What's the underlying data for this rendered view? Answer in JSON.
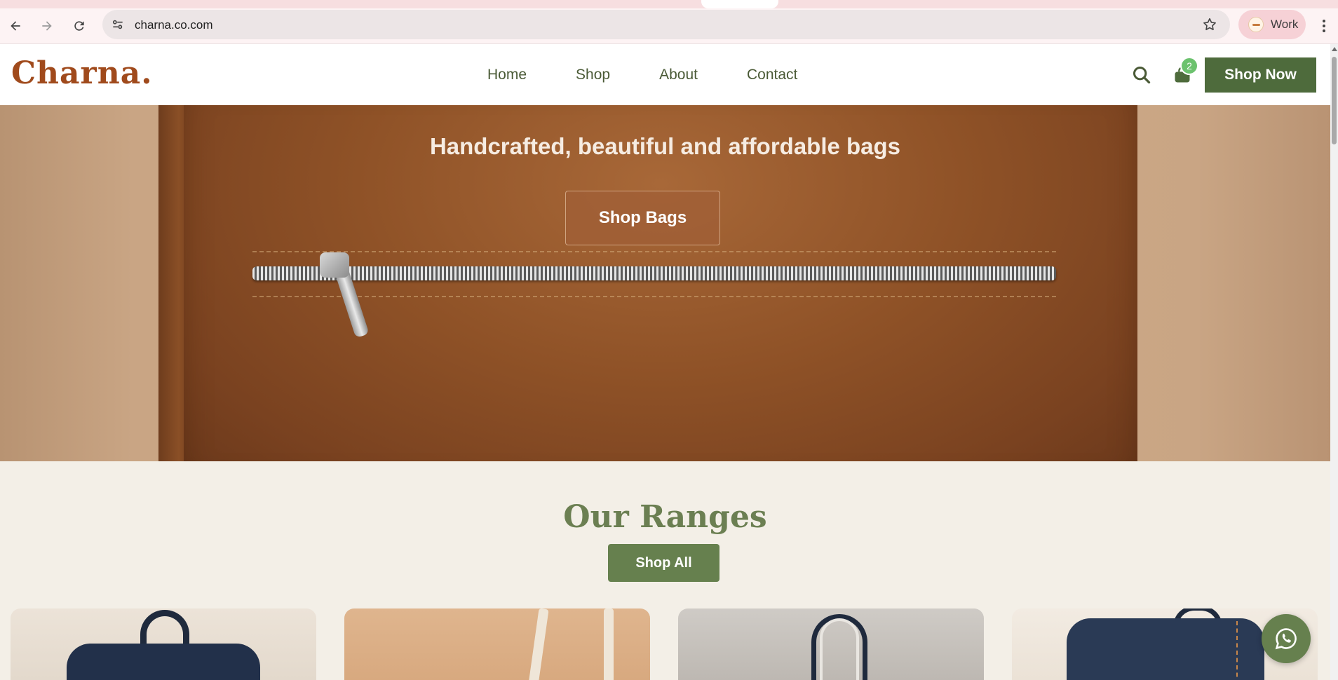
{
  "browser": {
    "url": "charna.co.com",
    "profile_label": "Work",
    "icons": {
      "back": "arrow-left-icon",
      "forward": "arrow-right-icon",
      "reload": "reload-icon",
      "site_info": "tune-icon",
      "bookmark": "star-icon",
      "menu": "more-vert-icon"
    }
  },
  "header": {
    "logo": "Charna.",
    "nav": [
      "Home",
      "Shop",
      "About",
      "Contact"
    ],
    "cart_count": "2",
    "cta_label": "Shop Now",
    "icons": {
      "search": "search-icon",
      "cart": "shopping-bag-icon"
    }
  },
  "hero": {
    "tagline": "Handcrafted, beautiful and affordable bags",
    "cta_label": "Shop Bags"
  },
  "ranges": {
    "title": "Our Ranges",
    "cta_label": "Shop All"
  },
  "floating": {
    "icon": "whatsapp-icon"
  },
  "colors": {
    "brand_rust": "#a04a1c",
    "brand_green": "#4e6b3c",
    "accent_green": "#66804e",
    "badge_green": "#6cc26e",
    "page_bg": "#f3efe7"
  }
}
